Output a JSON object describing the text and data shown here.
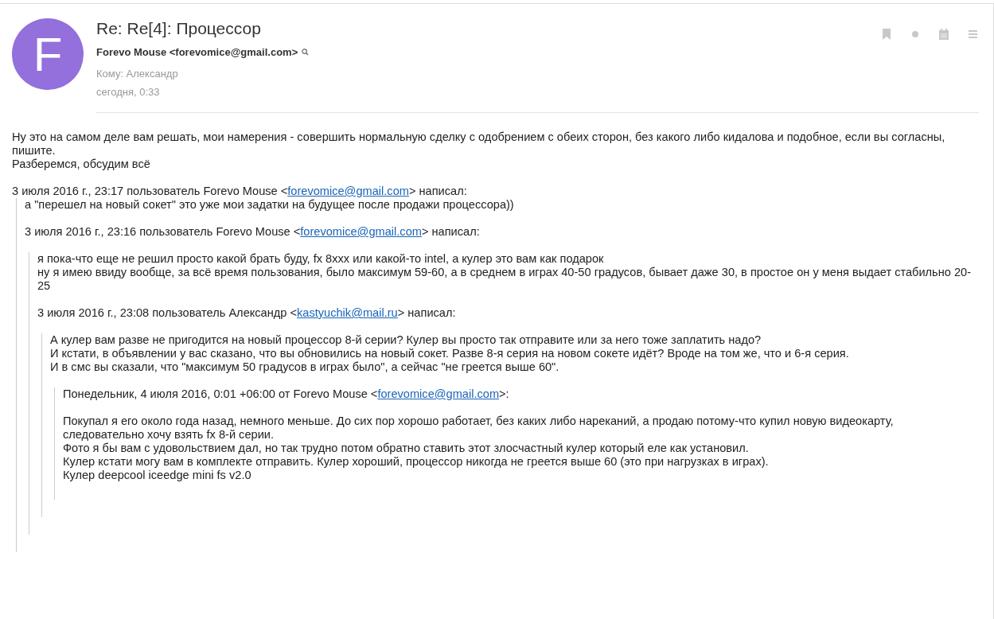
{
  "message": {
    "avatar_letter": "F",
    "subject": "Re: Re[4]: Процессор",
    "sender": "Forevo Mouse <forevomice@gmail.com>",
    "to": "Кому: Александр",
    "date": "сегодня, 0:33"
  },
  "body": [
    {
      "kind": "text",
      "text": "Ну это на самом деле вам решать, мои намерения - совершить нормальную сделку с одобрением с обеих сторон, без какого либо кидалова и подобное, если вы согласны, пишите."
    },
    {
      "kind": "text",
      "text": "Разберемся, обсудим всё"
    },
    {
      "kind": "gap"
    },
    {
      "kind": "attribution",
      "before": "3 июля 2016 г., 23:17 пользователь Forevo Mouse <",
      "link": "forevomice@gmail.com",
      "after": "> написал:"
    },
    {
      "kind": "quote",
      "items": [
        {
          "kind": "text",
          "text": "а \"перешел на новый сокет\" это уже мои задатки на будущее после продажи процессора))"
        },
        {
          "kind": "gap"
        },
        {
          "kind": "attribution",
          "before": "3 июля 2016 г., 23:16 пользователь Forevo Mouse <",
          "link": "forevomice@gmail.com",
          "after": "> написал:"
        },
        {
          "kind": "gap"
        },
        {
          "kind": "quote",
          "items": [
            {
              "kind": "text",
              "text": "я пока-что еще не решил просто какой брать буду, fx 8xxx или какой-то intel, а кулер это вам как подарок"
            },
            {
              "kind": "text",
              "text": "ну я имею ввиду вообще, за всё время пользования, было максимум 59-60, а в среднем в играх 40-50 градусов, бывает даже 30, в простое он у меня выдает стабильно 20-25"
            },
            {
              "kind": "gap"
            },
            {
              "kind": "attribution",
              "before": "3 июля 2016 г., 23:08 пользователь Александр <",
              "link": "kastyuchik@mail.ru",
              "after": "> написал:"
            },
            {
              "kind": "gap"
            },
            {
              "kind": "quote",
              "items": [
                {
                  "kind": "text",
                  "text": "А кулер вам разве не пригодится на новый процессор 8-й серии? Кулер вы просто так отправите или за него тоже заплатить надо?"
                },
                {
                  "kind": "text",
                  "text": "И кстати, в объявлении у вас сказано, что вы обновились на новый сокет. Разве 8-я серия на новом сокете идёт? Вроде на том же, что и 6-я серия."
                },
                {
                  "kind": "text",
                  "text": "И в смс вы сказали, что \"максимум 50 градусов в играх было\", а сейчас \"не греется выше 60\"."
                },
                {
                  "kind": "gap"
                },
                {
                  "kind": "quote",
                  "items": [
                    {
                      "kind": "attribution",
                      "before": "Понедельник, 4 июля 2016, 0:01 +06:00 от Forevo Mouse <",
                      "link": "forevomice@gmail.com",
                      "after": ">:"
                    },
                    {
                      "kind": "gap"
                    },
                    {
                      "kind": "text",
                      "text": "Покупал я его около года назад, немного меньше. До сих пор хорошо работает, без каких либо нареканий, а продаю потому-что купил новую видеокарту, следовательно хочу взять fx 8-й серии."
                    },
                    {
                      "kind": "text",
                      "text": "Фото я бы вам с удовольствием дал, но так трудно потом обратно ставить этот злосчастный кулер который еле как установил."
                    },
                    {
                      "kind": "text",
                      "text": "Кулер кстати могу вам в комплекте отправить. Кулер хороший, процессор никогда не греется выше 60 (это при нагрузках в играх)."
                    },
                    {
                      "kind": "text",
                      "text": "Кулер deepcool iceedge mini fs v2.0"
                    }
                  ]
                }
              ]
            }
          ]
        }
      ]
    }
  ]
}
